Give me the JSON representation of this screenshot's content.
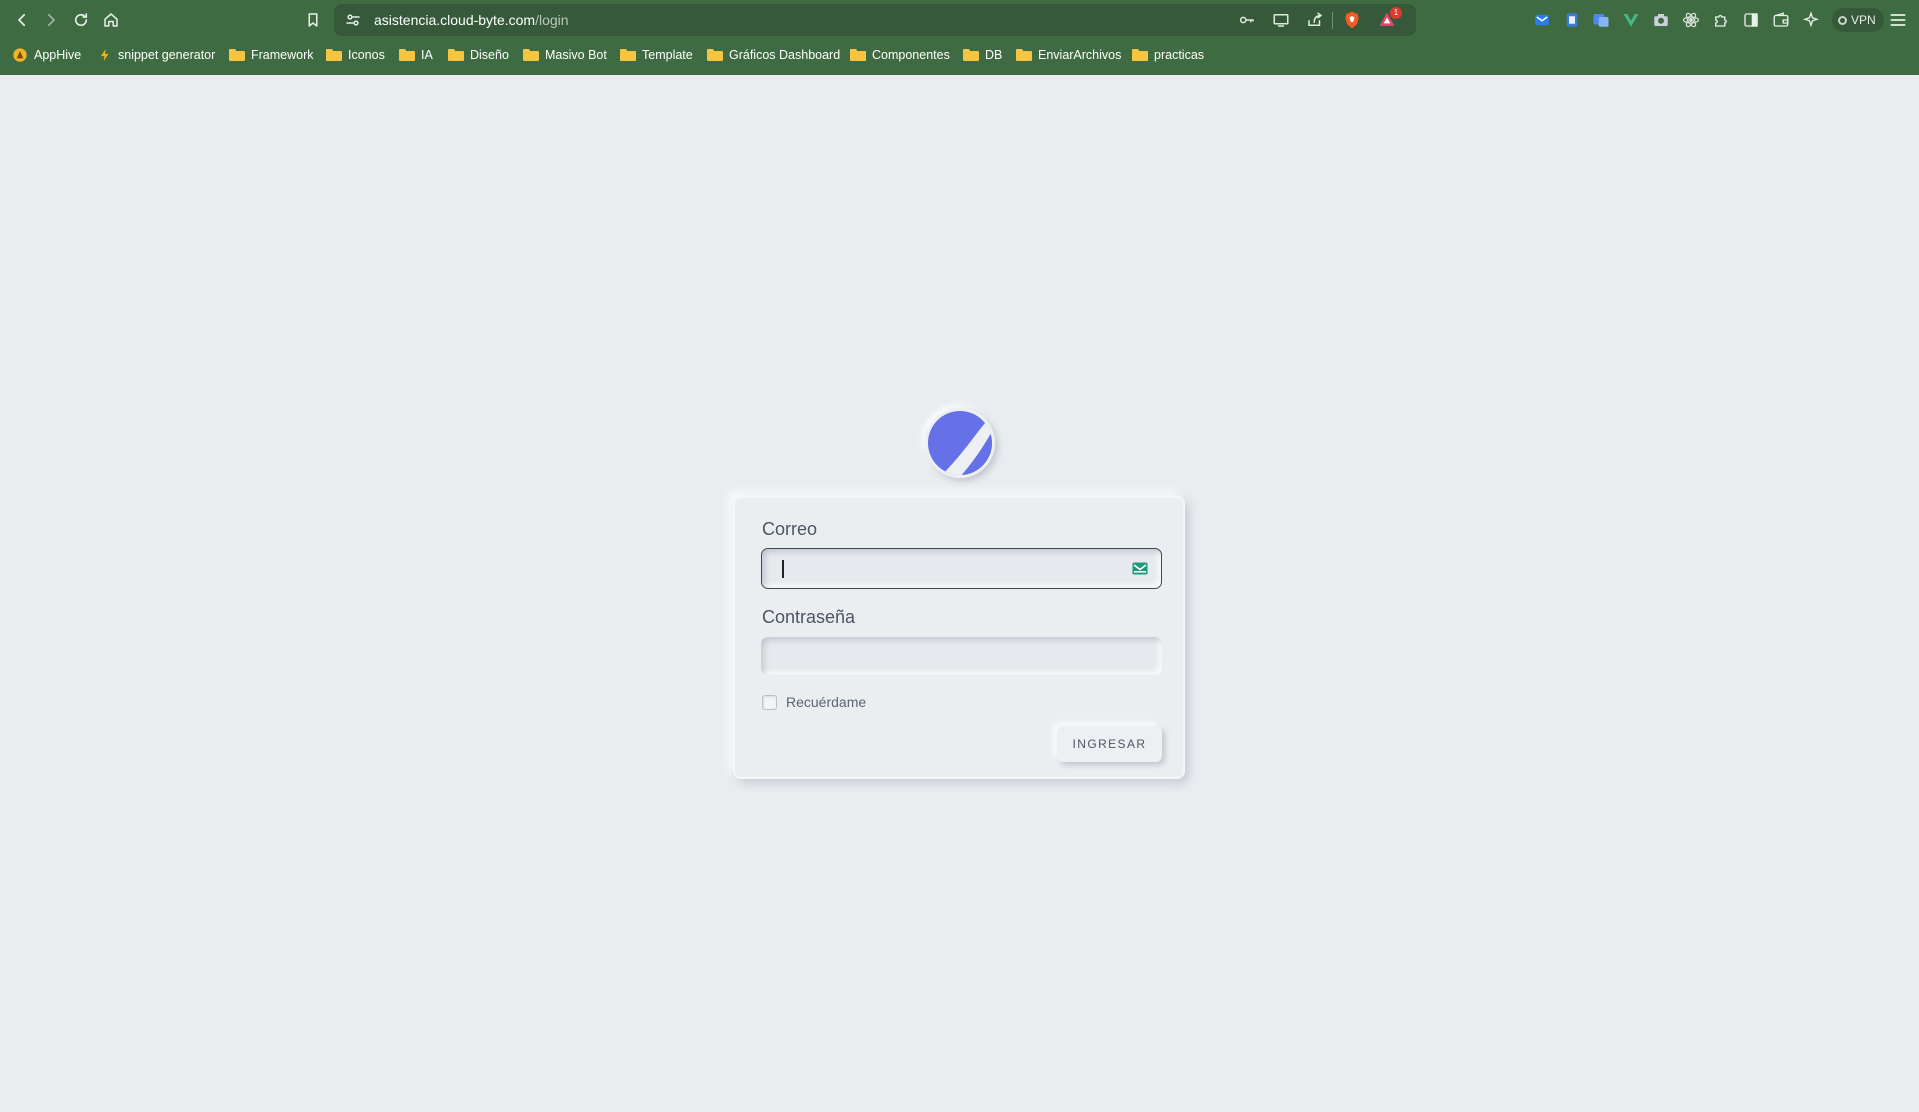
{
  "browser": {
    "url_host": "asistencia.cloud-byte.com",
    "url_path": "/login",
    "rewards_badge": "1",
    "vpn_label": "VPN",
    "bookmarks": [
      {
        "label": "AppHive",
        "icon": "apphive-icon"
      },
      {
        "label": "snippet generator",
        "icon": "spark-icon"
      },
      {
        "label": "Framework",
        "icon": "folder-icon"
      },
      {
        "label": "Iconos",
        "icon": "folder-icon"
      },
      {
        "label": "IA",
        "icon": "folder-icon"
      },
      {
        "label": "Diseño",
        "icon": "folder-icon"
      },
      {
        "label": "Masivo Bot",
        "icon": "folder-icon"
      },
      {
        "label": "Template",
        "icon": "folder-icon"
      },
      {
        "label": "Gráficos Dashboard",
        "icon": "folder-icon"
      },
      {
        "label": "Componentes",
        "icon": "folder-icon"
      },
      {
        "label": "DB",
        "icon": "folder-icon"
      },
      {
        "label": "EnviarArchivos",
        "icon": "folder-icon"
      },
      {
        "label": "practicas",
        "icon": "folder-icon"
      }
    ]
  },
  "login": {
    "email_label": "Correo",
    "email_value": "",
    "password_label": "Contraseña",
    "password_value": "",
    "remember_label": "Recuérdame",
    "remember_checked": false,
    "submit_label": "INGRESAR"
  },
  "colors": {
    "chrome_bg": "#3f6b43",
    "page_bg": "#e9edf0",
    "logo_accent": "#6671e8",
    "mail_icon": "#1f9a7a"
  }
}
